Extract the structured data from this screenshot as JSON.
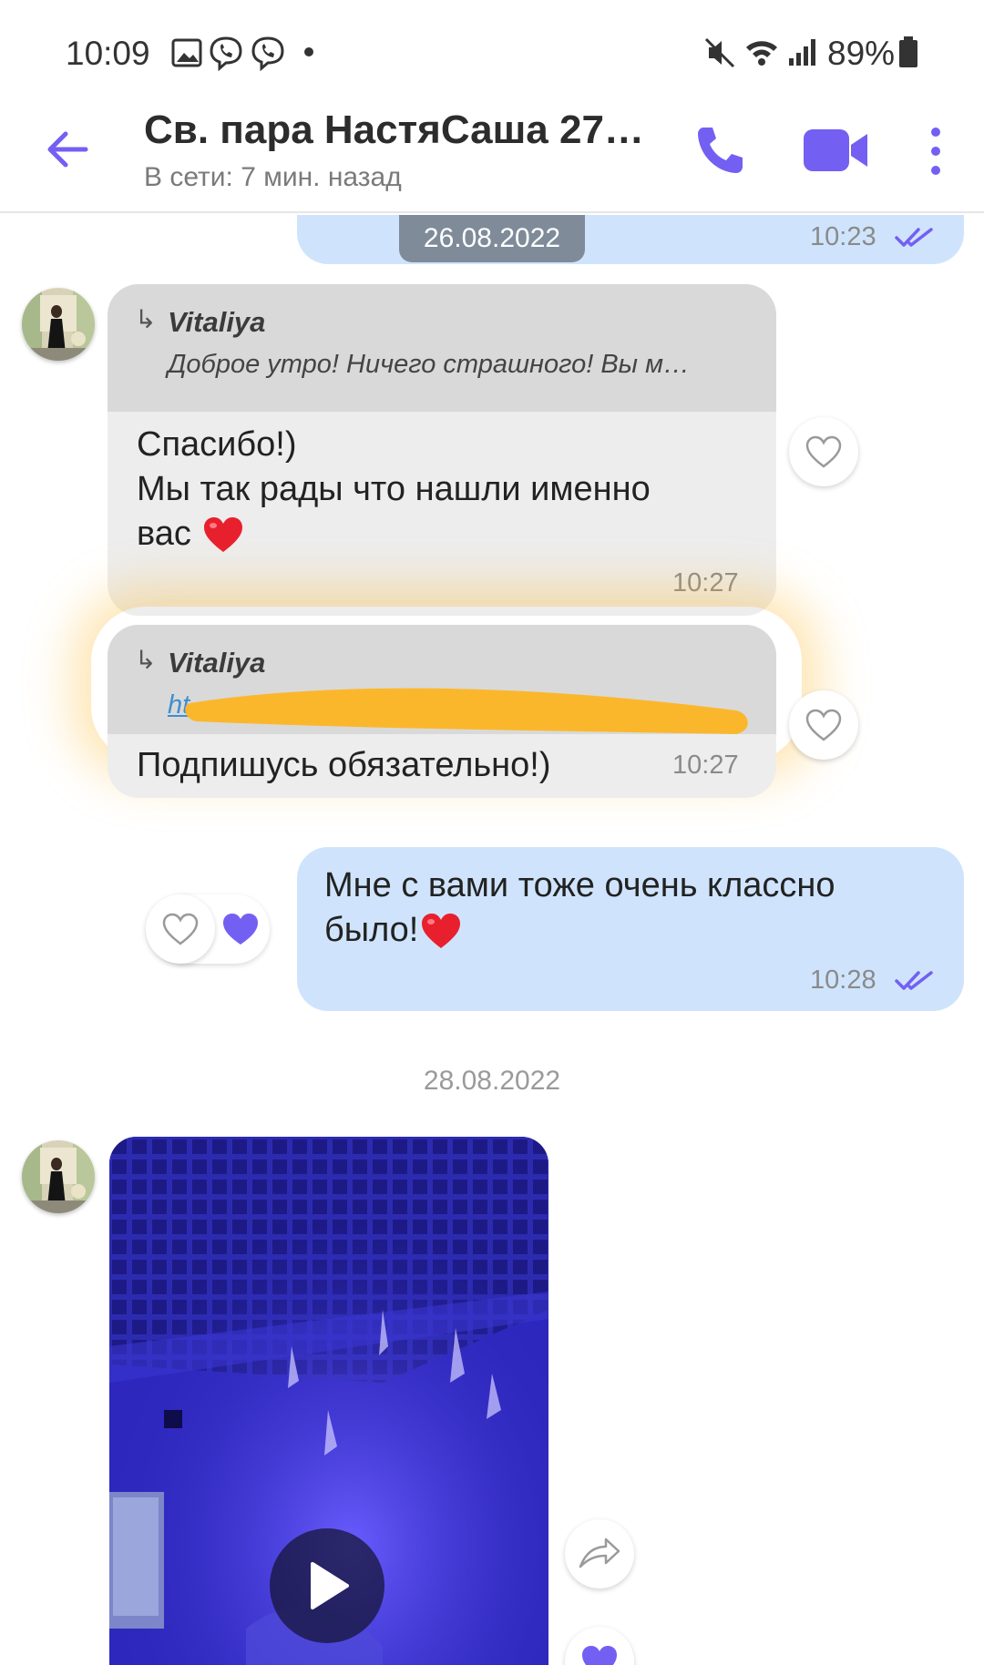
{
  "status_bar": {
    "time": "10:09",
    "battery": "89%"
  },
  "header": {
    "title": "Св. пара НастяСаша 27…",
    "subtitle": "В сети: 7 мин. назад"
  },
  "messages": [
    {
      "direction": "outgoing",
      "date_chip": "26.08.2022",
      "time": "10:23",
      "status": "read"
    },
    {
      "direction": "incoming",
      "quote_author": "Vitaliya",
      "quote_text": "Доброе утро! Ничего страшного! Вы м…",
      "text_lines": [
        "Спасибо!)",
        "Мы так рады что нашли именно",
        "вас"
      ],
      "time": "10:27",
      "liked": false
    },
    {
      "direction": "incoming",
      "quote_author": "Vitaliya",
      "quote_text": "ht",
      "text": "Подпишусь обязательно!)",
      "time": "10:27",
      "liked": false
    },
    {
      "direction": "outgoing",
      "text_lines": [
        "Мне с вами тоже очень классно",
        "было!"
      ],
      "time": "10:28",
      "status": "read",
      "liked_by_other": true
    },
    {
      "direction": "incoming",
      "date_separator": "28.08.2022",
      "type": "video"
    }
  ],
  "colors": {
    "accent": "#7360f2",
    "outgoing_bubble": "#cfe4fc",
    "incoming_bubble": "#ededed",
    "quote_bg": "#d9d9d9",
    "highlight": "#fbb72c"
  }
}
